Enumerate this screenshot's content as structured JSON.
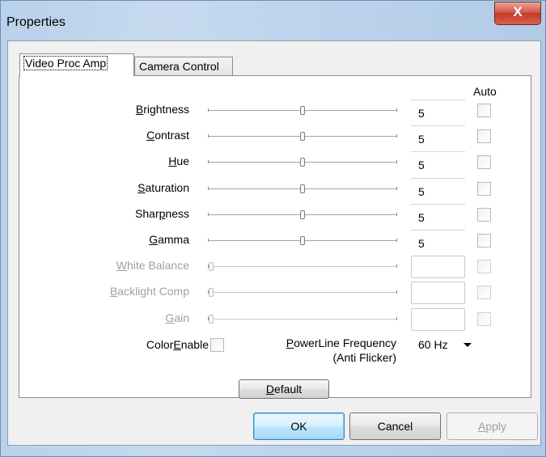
{
  "window": {
    "title": "Properties",
    "close_label": "X"
  },
  "tabs": [
    {
      "label": "Video Proc Amp",
      "active": true
    },
    {
      "label": "Camera Control",
      "active": false
    }
  ],
  "auto_header": "Auto",
  "rows": [
    {
      "label": "Brightness",
      "underline": "B",
      "value": "5",
      "enabled": true,
      "level": 0.5,
      "auto": false
    },
    {
      "label": "Contrast",
      "underline": "C",
      "value": "5",
      "enabled": true,
      "level": 0.5,
      "auto": false
    },
    {
      "label": "Hue",
      "underline": "H",
      "value": "5",
      "enabled": true,
      "level": 0.5,
      "auto": false
    },
    {
      "label": "Saturation",
      "underline": "S",
      "value": "5",
      "enabled": true,
      "level": 0.5,
      "auto": false
    },
    {
      "label": "Sharpness",
      "underline": "p",
      "value": "5",
      "enabled": true,
      "level": 0.5,
      "auto": false
    },
    {
      "label": "Gamma",
      "underline": "G",
      "value": "5",
      "enabled": true,
      "level": 0.5,
      "auto": false
    },
    {
      "label": "White Balance",
      "underline": "W",
      "value": "",
      "enabled": false,
      "level": 0,
      "auto": false
    },
    {
      "label": "Backlight Comp",
      "underline": "B",
      "value": "",
      "enabled": false,
      "level": 0,
      "auto": false
    },
    {
      "label": "Gain",
      "underline": "G",
      "value": "",
      "enabled": false,
      "level": 0,
      "auto": false
    }
  ],
  "color_enable": {
    "label": "ColorEnable",
    "underline": "E",
    "checked": false
  },
  "powerline": {
    "label_line1": "PowerLine Frequency",
    "label_line2": "(Anti Flicker)",
    "underline": "P",
    "selected": "60 Hz"
  },
  "buttons": {
    "default": "Default",
    "ok": "OK",
    "cancel": "Cancel",
    "apply": "Apply"
  }
}
